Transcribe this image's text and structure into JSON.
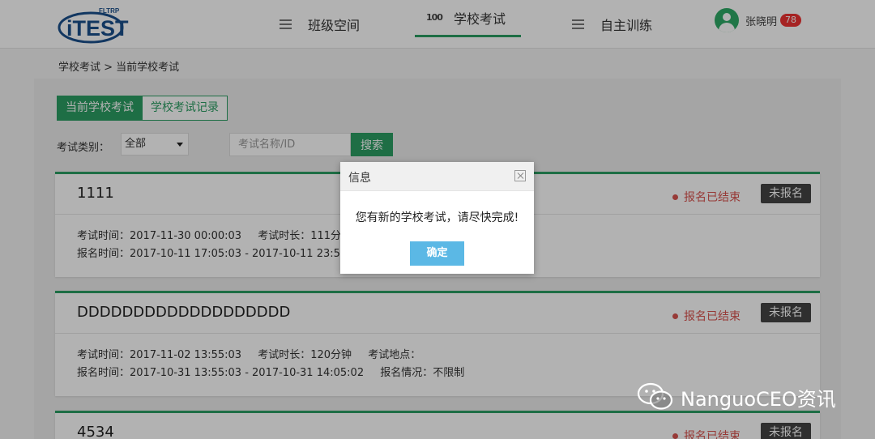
{
  "logo": {
    "text": "iTEST",
    "sub": "FLTRP"
  },
  "nav": [
    {
      "label": "班级空间",
      "icon": "menu-icon"
    },
    {
      "label": "学校考试",
      "icon": "score-100-icon",
      "icon_text": "100"
    },
    {
      "label": "自主训练",
      "icon": "menu-icon"
    }
  ],
  "user": {
    "name": "张晓明",
    "badge": "78"
  },
  "breadcrumb": "学校考试 > 当前学校考试",
  "tabs": [
    "当前学校考试",
    "学校考试记录"
  ],
  "filter": {
    "label": "考试类别：",
    "selected": "全部",
    "search_placeholder": "考试名称/ID",
    "search_button": "搜索"
  },
  "cards": [
    {
      "title": "1111",
      "status": "报名已结束",
      "register_button": "未报名",
      "exam_time": "考试时间：2017-11-30 00:00:03",
      "duration": "考试时长：111分",
      "signup_time": "报名时间：2017-10-11 17:05:03 - 2017-10-11 23:5",
      "location": "",
      "signup_status": ""
    },
    {
      "title": "DDDDDDDDDDDDDDDDDDD",
      "status": "报名已结束",
      "register_button": "未报名",
      "exam_time": "考试时间：2017-11-02 13:55:03",
      "duration": "考试时长：120分钟",
      "location": "考试地点：",
      "signup_time": "报名时间：2017-10-31 13:55:03 - 2017-10-31 14:05:02",
      "signup_status": "报名情况：不限制"
    },
    {
      "title": "4534",
      "status": "报名已结束",
      "register_button": "未报名"
    }
  ],
  "dialog": {
    "title": "信息",
    "message": "您有新的学校考试，请尽快完成!",
    "ok": "确定"
  },
  "watermark": "NanguoCEO资讯",
  "colors": {
    "accent": "#2c9e63",
    "status": "#d9534f",
    "dialog_button": "#5bb8e5",
    "badge": "#e33333"
  }
}
